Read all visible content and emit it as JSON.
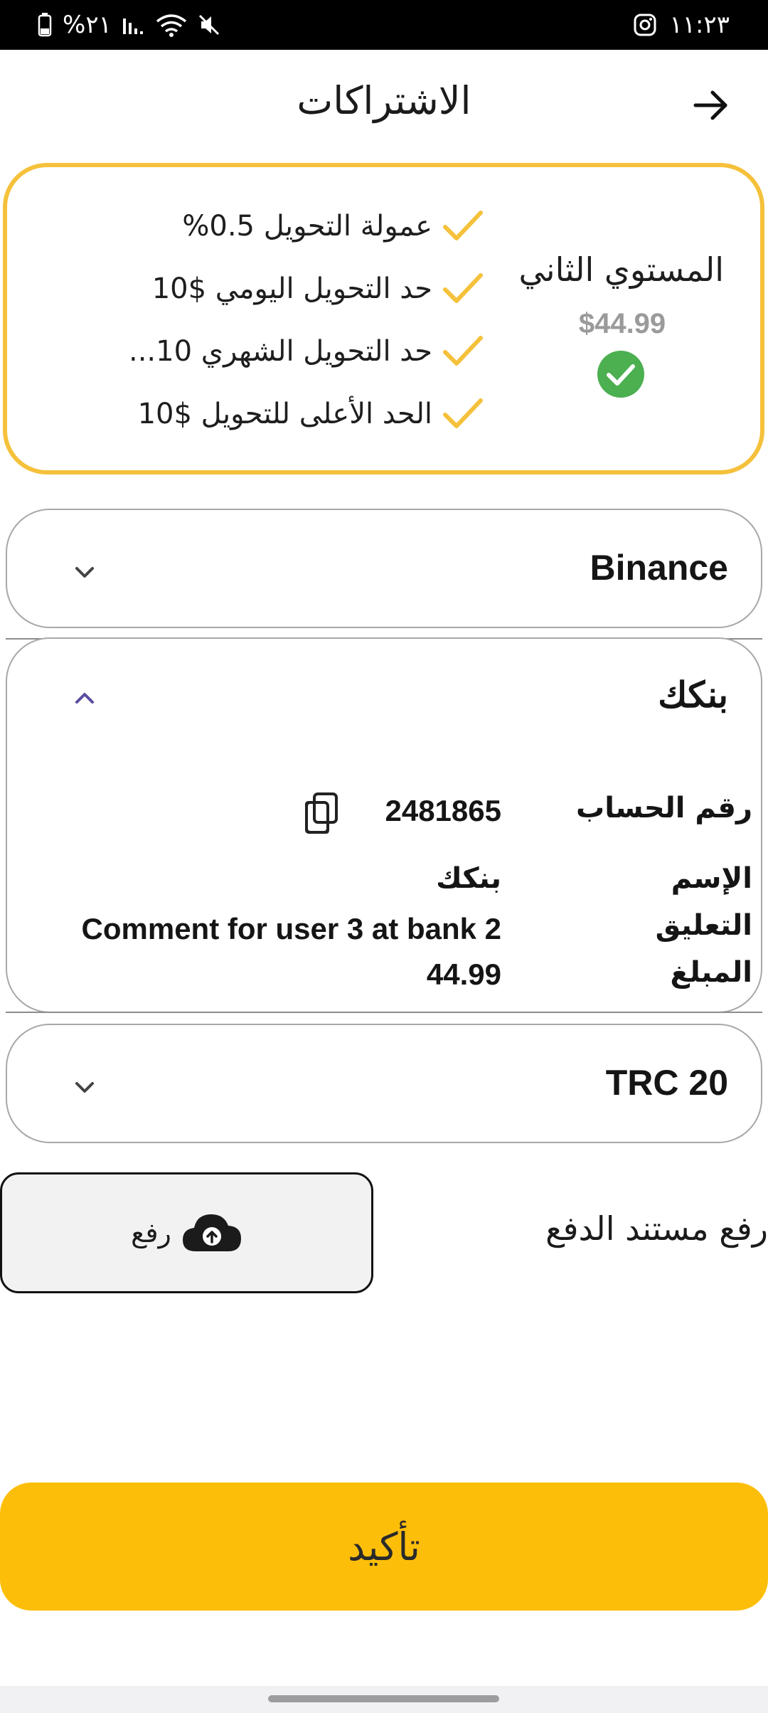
{
  "status_bar": {
    "battery_text": "%٢١",
    "time": "١١:٢٣"
  },
  "header": {
    "title": "الاشتراكات"
  },
  "plan": {
    "name": "المستوي الثاني",
    "price": "$44.99",
    "features": [
      "عمولة التحويل 0.5%",
      "حد التحويل اليومي $10",
      "حد التحويل الشهري 10...",
      "الحد الأعلى للتحويل $10"
    ],
    "accent_color": "#f5c13b",
    "selected_color": "#4caf50"
  },
  "payment_methods": [
    {
      "title": "Binance",
      "expanded": false
    },
    {
      "title": "بنكك",
      "expanded": true,
      "details": {
        "account_label": "رقم الحساب",
        "account_value": "2481865",
        "name_label": "الإسم",
        "name_value": "بنكك",
        "comment_label": "التعليق",
        "comment_value": "Comment for user 3 at bank 2",
        "amount_label": "المبلغ",
        "amount_value": "44.99"
      }
    },
    {
      "title": "TRC 20",
      "expanded": false
    }
  ],
  "upload": {
    "label": "رفع مستند الدفع",
    "button_label": "رفع",
    "icon": "cloud-upload-icon"
  },
  "confirm": {
    "label": "تأكيد",
    "color": "#fdbe0a"
  }
}
